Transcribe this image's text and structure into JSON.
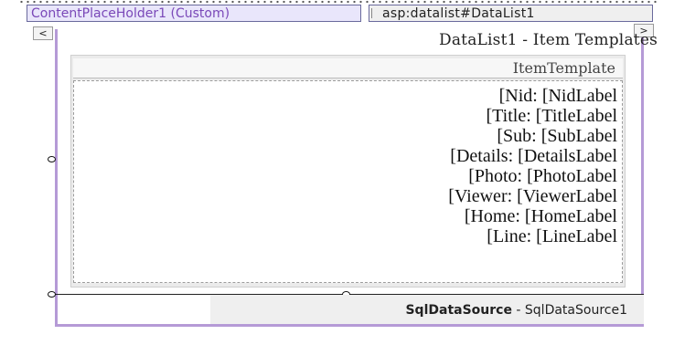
{
  "tabs": {
    "content_placeholder": "ContentPlaceHolder1 (Custom)",
    "datalist": "asp:datalist#DataList1"
  },
  "nav": {
    "left": "<",
    "right": ">"
  },
  "panel": {
    "title": "DataList1 - Item Templates",
    "template_header": "ItemTemplate"
  },
  "item_template": [
    {
      "label": "[Nid:",
      "value": "[NidLabel"
    },
    {
      "label": "[Title:",
      "value": "[TitleLabel"
    },
    {
      "label": "[Sub:",
      "value": "[SubLabel"
    },
    {
      "label": "[Details:",
      "value": "[DetailsLabel"
    },
    {
      "label": "[Photo:",
      "value": "[PhotoLabel"
    },
    {
      "label": "[Viewer:",
      "value": "[ViewerLabel"
    },
    {
      "label": "[Home:",
      "value": "[HomeLabel"
    },
    {
      "label": "[Line:",
      "value": "[LineLabel"
    }
  ],
  "datasource": {
    "type": "SqlDataSource",
    "separator": " - ",
    "name": "SqlDataSource1"
  },
  "colors": {
    "panel_border": "#b59ad6",
    "cph_tab_text": "#7a48b8"
  }
}
